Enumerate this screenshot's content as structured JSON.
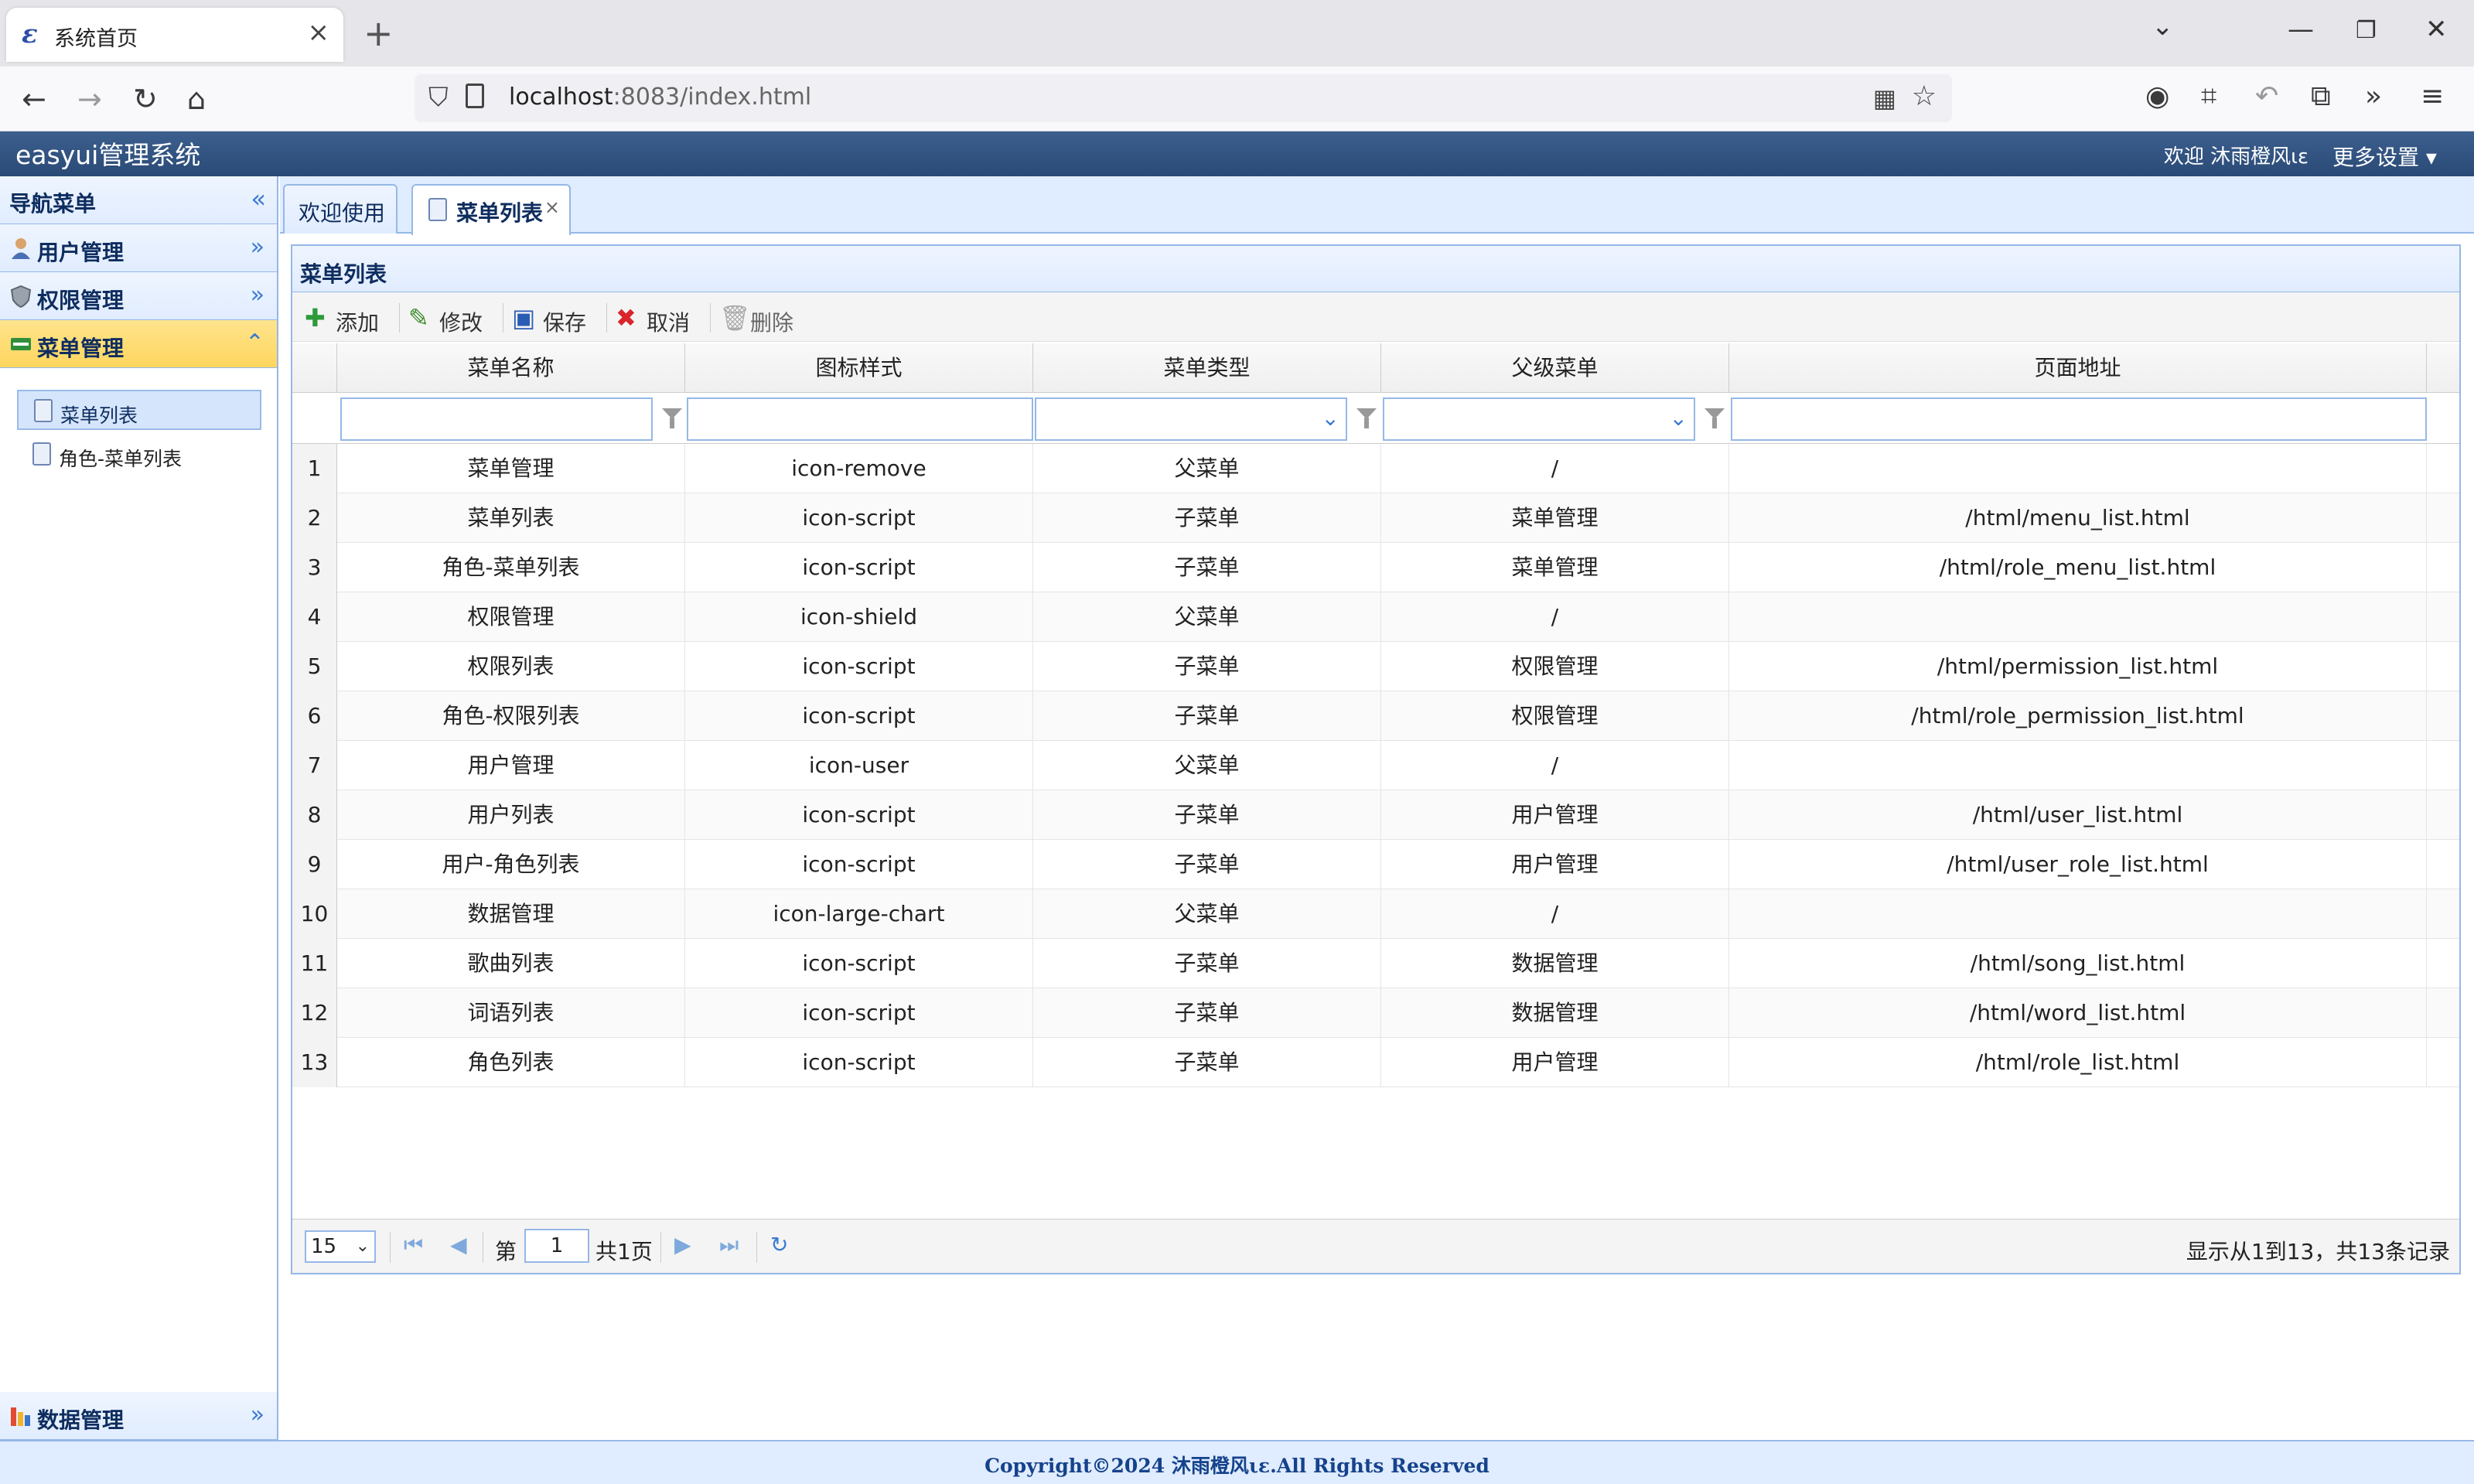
{
  "browser": {
    "tab_title": "系统首页",
    "tab_logo": "ε",
    "url_host": "localhost",
    "url_rest": ":8083/index.html",
    "icons": [
      "back-icon",
      "forward-icon",
      "reload-icon",
      "home-icon",
      "shield-icon",
      "page-icon",
      "qr-code-icon",
      "bookmark-star-icon",
      "account-icon",
      "crop-icon",
      "undo-icon",
      "extensions-icon",
      "overflow-chevrons-icon",
      "menu-icon"
    ]
  },
  "app": {
    "title": "easyui管理系统",
    "welcome": "欢迎 沐雨橙风ιε",
    "more_settings": "更多设置"
  },
  "sidebar": {
    "header": "导航菜单",
    "sections": [
      {
        "title": "用户管理",
        "icon": "user-icon"
      },
      {
        "title": "权限管理",
        "icon": "shield-icon"
      },
      {
        "title": "菜单管理",
        "icon": "menu-icon"
      },
      {
        "title": "数据管理",
        "icon": "chart-icon"
      }
    ],
    "tree": [
      {
        "label": "菜单列表"
      },
      {
        "label": "角色-菜单列表"
      }
    ]
  },
  "tabs": [
    {
      "label": "欢迎使用"
    },
    {
      "label": "菜单列表",
      "close": "×"
    }
  ],
  "panel": {
    "title": "菜单列表",
    "toolbar": {
      "add": "添加",
      "edit": "修改",
      "save": "保存",
      "cancel": "取消",
      "delete": "删除"
    }
  },
  "grid": {
    "columns": [
      "菜单名称",
      "图标样式",
      "菜单类型",
      "父级菜单",
      "页面地址"
    ],
    "rows": [
      {
        "n": "1",
        "name": "菜单管理",
        "icon": "icon-remove",
        "type": "父菜单",
        "parent": "/",
        "url": ""
      },
      {
        "n": "2",
        "name": "菜单列表",
        "icon": "icon-script",
        "type": "子菜单",
        "parent": "菜单管理",
        "url": "/html/menu_list.html"
      },
      {
        "n": "3",
        "name": "角色-菜单列表",
        "icon": "icon-script",
        "type": "子菜单",
        "parent": "菜单管理",
        "url": "/html/role_menu_list.html"
      },
      {
        "n": "4",
        "name": "权限管理",
        "icon": "icon-shield",
        "type": "父菜单",
        "parent": "/",
        "url": ""
      },
      {
        "n": "5",
        "name": "权限列表",
        "icon": "icon-script",
        "type": "子菜单",
        "parent": "权限管理",
        "url": "/html/permission_list.html"
      },
      {
        "n": "6",
        "name": "角色-权限列表",
        "icon": "icon-script",
        "type": "子菜单",
        "parent": "权限管理",
        "url": "/html/role_permission_list.html"
      },
      {
        "n": "7",
        "name": "用户管理",
        "icon": "icon-user",
        "type": "父菜单",
        "parent": "/",
        "url": ""
      },
      {
        "n": "8",
        "name": "用户列表",
        "icon": "icon-script",
        "type": "子菜单",
        "parent": "用户管理",
        "url": "/html/user_list.html"
      },
      {
        "n": "9",
        "name": "用户-角色列表",
        "icon": "icon-script",
        "type": "子菜单",
        "parent": "用户管理",
        "url": "/html/user_role_list.html"
      },
      {
        "n": "10",
        "name": "数据管理",
        "icon": "icon-large-chart",
        "type": "父菜单",
        "parent": "/",
        "url": ""
      },
      {
        "n": "11",
        "name": "歌曲列表",
        "icon": "icon-script",
        "type": "子菜单",
        "parent": "数据管理",
        "url": "/html/song_list.html"
      },
      {
        "n": "12",
        "name": "词语列表",
        "icon": "icon-script",
        "type": "子菜单",
        "parent": "数据管理",
        "url": "/html/word_list.html"
      },
      {
        "n": "13",
        "name": "角色列表",
        "icon": "icon-script",
        "type": "子菜单",
        "parent": "用户管理",
        "url": "/html/role_list.html"
      }
    ]
  },
  "pager": {
    "page_size": "15",
    "page_prefix": "第",
    "page": "1",
    "page_suffix": "共1页",
    "info": "显示从1到13，共13条记录"
  },
  "footer": "Copyright©2024 沐雨橙风ιε.All Rights Reserved",
  "colors": {
    "header_blue": "#2a4a76",
    "border_blue": "#95b8e7",
    "active_section": "#ffd65e",
    "footer_text": "#15428b"
  }
}
